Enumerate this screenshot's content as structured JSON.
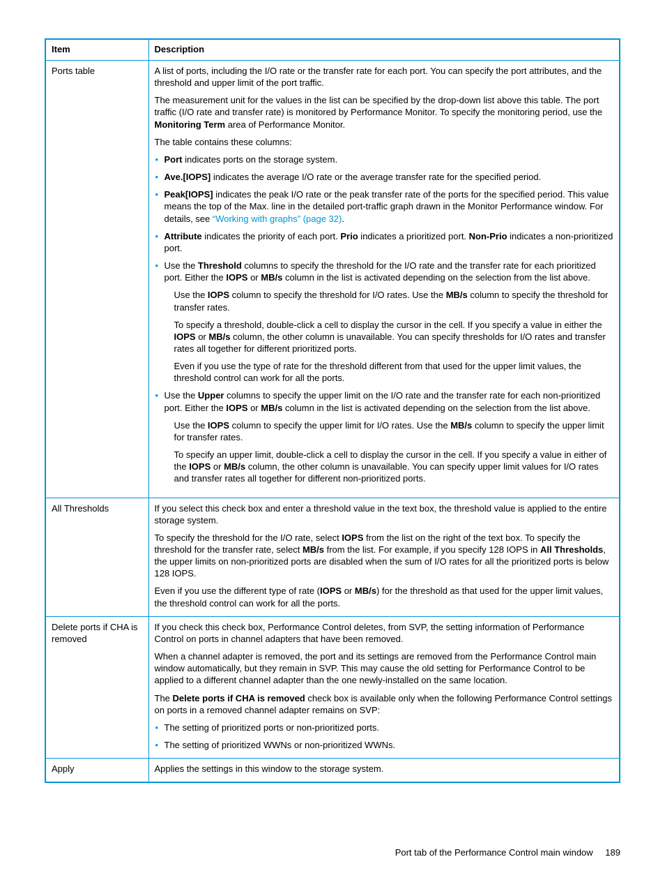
{
  "headers": {
    "item": "Item",
    "description": "Description"
  },
  "rows": {
    "ports": {
      "item": "Ports table",
      "p1": "A list of ports, including the I/O rate or the transfer rate for each port. You can specify the port attributes, and the threshold and upper limit of the port traffic.",
      "p2a": "The measurement unit for the values in the list can be specified by the drop-down list above this table. The port traffic (I/O rate and transfer rate) is monitored by Performance Monitor. To specify the monitoring period, use the ",
      "p2b": "Monitoring Term",
      "p2c": " area of Performance Monitor.",
      "p3": "The table contains these columns:",
      "b1a": "Port",
      "b1b": " indicates ports on the storage system.",
      "b2a": "Ave.[IOPS]",
      "b2b": " indicates the average I/O rate or the average transfer rate for the specified period.",
      "b3a": "Peak[IOPS]",
      "b3b": " indicates the peak I/O rate or the peak transfer rate of the ports for the specified period. This value means the top of the Max. line in the detailed port-traffic graph drawn in the Monitor Performance window. For details, see ",
      "b3link": "“Working with graphs” (page 32)",
      "b3c": ".",
      "b4a": "Attribute",
      "b4b": " indicates the priority of each port. ",
      "b4c": "Prio",
      "b4d": " indicates a prioritized port. ",
      "b4e": "Non-Prio",
      "b4f": " indicates a non-prioritized port.",
      "b5a": "Use the ",
      "b5b": "Threshold",
      "b5c": " columns to specify the threshold for the I/O rate and the transfer rate for each prioritized port. Either the ",
      "b5d": "IOPS",
      "b5e": " or ",
      "b5f": "MB/s",
      "b5g": " column in the list is activated depending on the selection from the list above.",
      "b5p2a": "Use the ",
      "b5p2b": "IOPS",
      "b5p2c": " column to specify the threshold for I/O rates. Use the ",
      "b5p2d": "MB/s",
      "b5p2e": " column to specify the threshold for transfer rates.",
      "b5p3a": "To specify a threshold, double-click a cell to display the cursor in the cell. If you specify a value in either the ",
      "b5p3b": "IOPS",
      "b5p3c": " or ",
      "b5p3d": "MB/s",
      "b5p3e": " column, the other column is unavailable. You can specify thresholds for I/O rates and transfer rates all together for different prioritized ports.",
      "b5p4": "Even if you use the type of rate for the threshold different from that used for the upper limit values, the threshold control can work for all the ports.",
      "b6a": "Use the ",
      "b6b": "Upper",
      "b6c": " columns to specify the upper limit on the I/O rate and the transfer rate for each non-prioritized port. Either the ",
      "b6d": "IOPS",
      "b6e": " or ",
      "b6f": "MB/s",
      "b6g": " column in the list is activated depending on the selection from the list above.",
      "b6p2a": "Use the ",
      "b6p2b": "IOPS",
      "b6p2c": " column to specify the upper limit for I/O rates. Use the ",
      "b6p2d": "MB/s",
      "b6p2e": " column to specify the upper limit for transfer rates.",
      "b6p3a": "To specify an upper limit, double-click a cell to display the cursor in the cell. If you specify a value in either of the ",
      "b6p3b": "IOPS",
      "b6p3c": " or ",
      "b6p3d": "MB/s",
      "b6p3e": " column, the other column is unavailable. You can specify upper limit values for I/O rates and transfer rates all together for different non-prioritized ports."
    },
    "thresh": {
      "item": "All Thresholds",
      "p1": "If you select this check box and enter a threshold value in the text box, the threshold value is applied to the entire storage system.",
      "p2a": "To specify the threshold for the I/O rate, select ",
      "p2b": "IOPS",
      "p2c": " from the list on the right of the text box. To specify the threshold for the transfer rate, select ",
      "p2d": "MB/s",
      "p2e": " from the list. For example, if you specify 128 IOPS in ",
      "p2f": "All Thresholds",
      "p2g": ", the upper limits on non-prioritized ports are disabled when the sum of I/O rates for all the prioritized ports is below 128 IOPS.",
      "p3a": "Even if you use the different type of rate (",
      "p3b": "IOPS",
      "p3c": " or ",
      "p3d": "MB/s",
      "p3e": ") for the threshold as that used for the upper limit values, the threshold control can work for all the ports."
    },
    "delete": {
      "item": "Delete ports if CHA is removed",
      "p1": "If you check this check box, Performance Control deletes, from SVP, the setting information of Performance Control on ports in channel adapters that have been removed.",
      "p2": "When a channel adapter is removed, the port and its settings are removed from the Performance Control main window automatically, but they remain in SVP. This may cause the old setting for Performance Control to be applied to a different channel adapter than the one newly-installed on the same location.",
      "p3a": "The ",
      "p3b": "Delete ports if CHA is removed",
      "p3c": " check box is available only when the following Performance Control settings on ports in a removed channel adapter remains on SVP:",
      "b1": "The setting of prioritized ports or non-prioritized ports.",
      "b2": "The setting of prioritized WWNs or non-prioritized WWNs."
    },
    "apply": {
      "item": "Apply",
      "p1": "Applies the settings in this window to the storage system."
    }
  },
  "footer": {
    "text": "Port tab of the Performance Control main window",
    "page": "189"
  }
}
